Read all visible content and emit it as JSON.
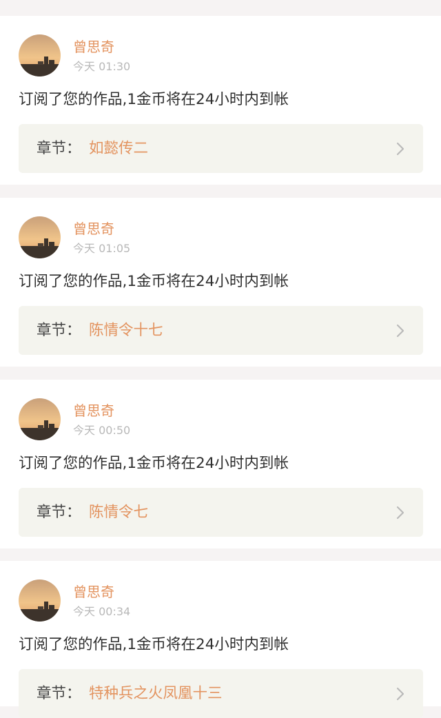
{
  "notifications": [
    {
      "user_name": "曾思奇",
      "timestamp": "今天 01:30",
      "message": "订阅了您的作品,1金币将在24小时内到帐",
      "chapter_label": "章节：",
      "chapter_title": "如懿传二"
    },
    {
      "user_name": "曾思奇",
      "timestamp": "今天 01:05",
      "message": "订阅了您的作品,1金币将在24小时内到帐",
      "chapter_label": "章节：",
      "chapter_title": "陈情令十七"
    },
    {
      "user_name": "曾思奇",
      "timestamp": "今天 00:50",
      "message": "订阅了您的作品,1金币将在24小时内到帐",
      "chapter_label": "章节：",
      "chapter_title": "陈情令七"
    },
    {
      "user_name": "曾思奇",
      "timestamp": "今天 00:34",
      "message": "订阅了您的作品,1金币将在24小时内到帐",
      "chapter_label": "章节：",
      "chapter_title": "特种兵之火凤凰十三"
    }
  ],
  "colors": {
    "accent": "#e3935f",
    "chapter_background": "#f4f4ee",
    "page_background": "#f6f3f3"
  },
  "icons": {
    "avatar": "sunset-avatar-image",
    "chapter_link": "chevron-right-icon"
  }
}
